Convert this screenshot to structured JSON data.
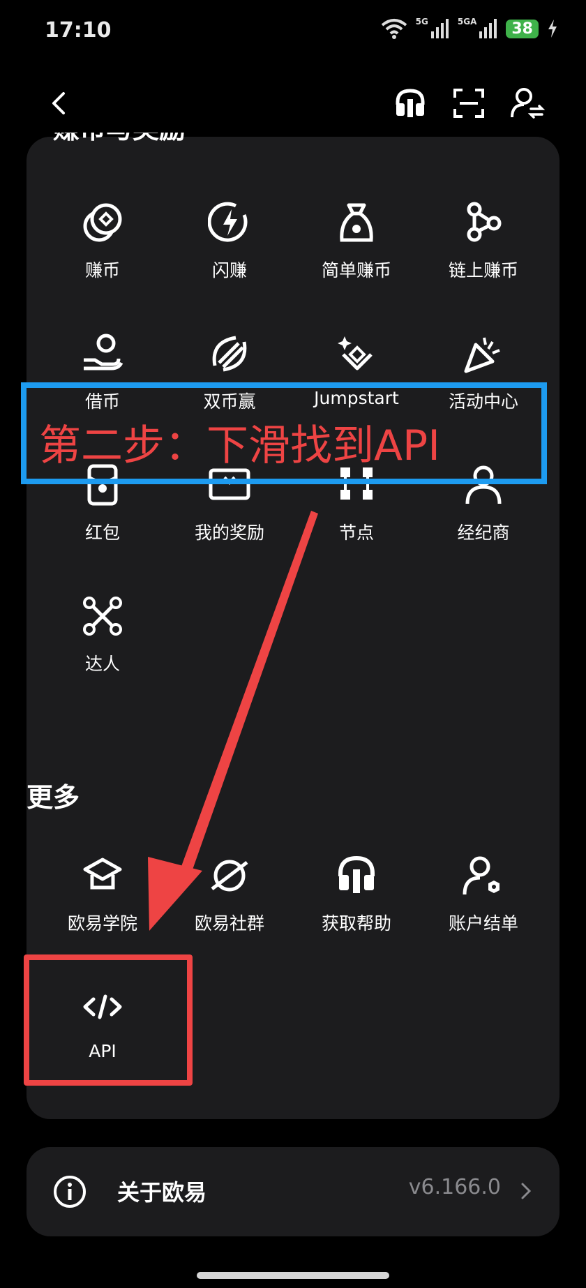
{
  "status_bar": {
    "time": "17:10",
    "network_1": "5G",
    "network_2": "5GA",
    "battery": "38"
  },
  "nav": {
    "back_icon": "chevron-left-icon",
    "support_icon": "headset-icon",
    "scan_icon": "scan-icon",
    "account_icon": "user-switch-icon"
  },
  "earn_section": {
    "title": "赚币与奖励",
    "items": [
      {
        "label": "赚币",
        "icon": "coins-icon"
      },
      {
        "label": "闪赚",
        "icon": "lightning-icon"
      },
      {
        "label": "简单赚币",
        "icon": "money-bag-icon"
      },
      {
        "label": "链上赚币",
        "icon": "nodes-icon"
      },
      {
        "label": "借币",
        "icon": "loan-hand-icon"
      },
      {
        "label": "双币赢",
        "icon": "dual-coin-icon"
      },
      {
        "label": "Jumpstart",
        "icon": "sparkle-diamond-icon"
      },
      {
        "label": "活动中心",
        "icon": "party-popper-icon"
      },
      {
        "label": "红包",
        "icon": "red-packet-icon"
      },
      {
        "label": "我的奖励",
        "icon": "reward-card-icon"
      },
      {
        "label": "节点",
        "icon": "node-blocks-icon"
      },
      {
        "label": "经纪商",
        "icon": "broker-user-icon"
      },
      {
        "label": "达人",
        "icon": "drone-icon"
      }
    ]
  },
  "more_section": {
    "title": "更多",
    "items": [
      {
        "label": "欧易学院",
        "icon": "graduation-cap-icon"
      },
      {
        "label": "欧易社群",
        "icon": "planet-icon"
      },
      {
        "label": "获取帮助",
        "icon": "headset-icon"
      },
      {
        "label": "账户结单",
        "icon": "user-settings-icon"
      },
      {
        "label": "API",
        "icon": "code-icon"
      }
    ]
  },
  "about": {
    "label": "关于欧易",
    "version": "v6.166.0",
    "icon": "info-icon"
  },
  "annotation": {
    "text": "第二步：下滑找到API",
    "box_color": "#1d9bf0",
    "highlight_color": "#ee4444"
  }
}
